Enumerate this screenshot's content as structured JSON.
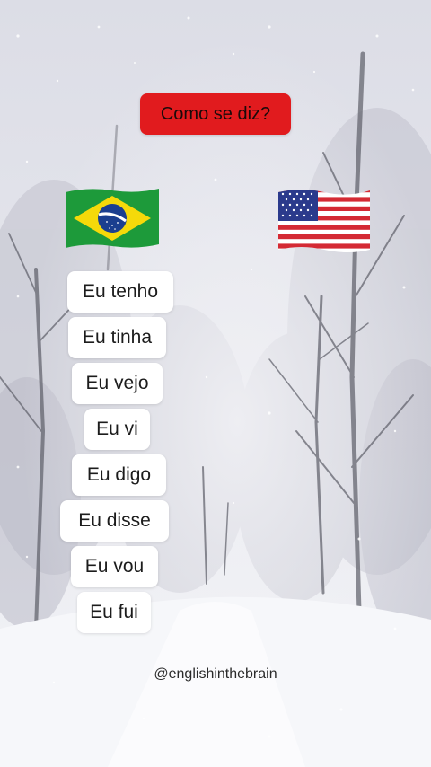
{
  "title": "Como se diz?",
  "flags": {
    "left_icon": "brazil-flag-icon",
    "right_icon": "usa-flag-icon"
  },
  "phrases": [
    "Eu tenho",
    "Eu tinha",
    "Eu vejo",
    "Eu vi",
    "Eu digo",
    "Eu disse",
    "Eu vou",
    "Eu fui"
  ],
  "handle": "@englishinthebrain",
  "colors": {
    "badge_red": "#e11b1e",
    "card_white": "#ffffff",
    "snow_background": "#e9eaf0"
  }
}
